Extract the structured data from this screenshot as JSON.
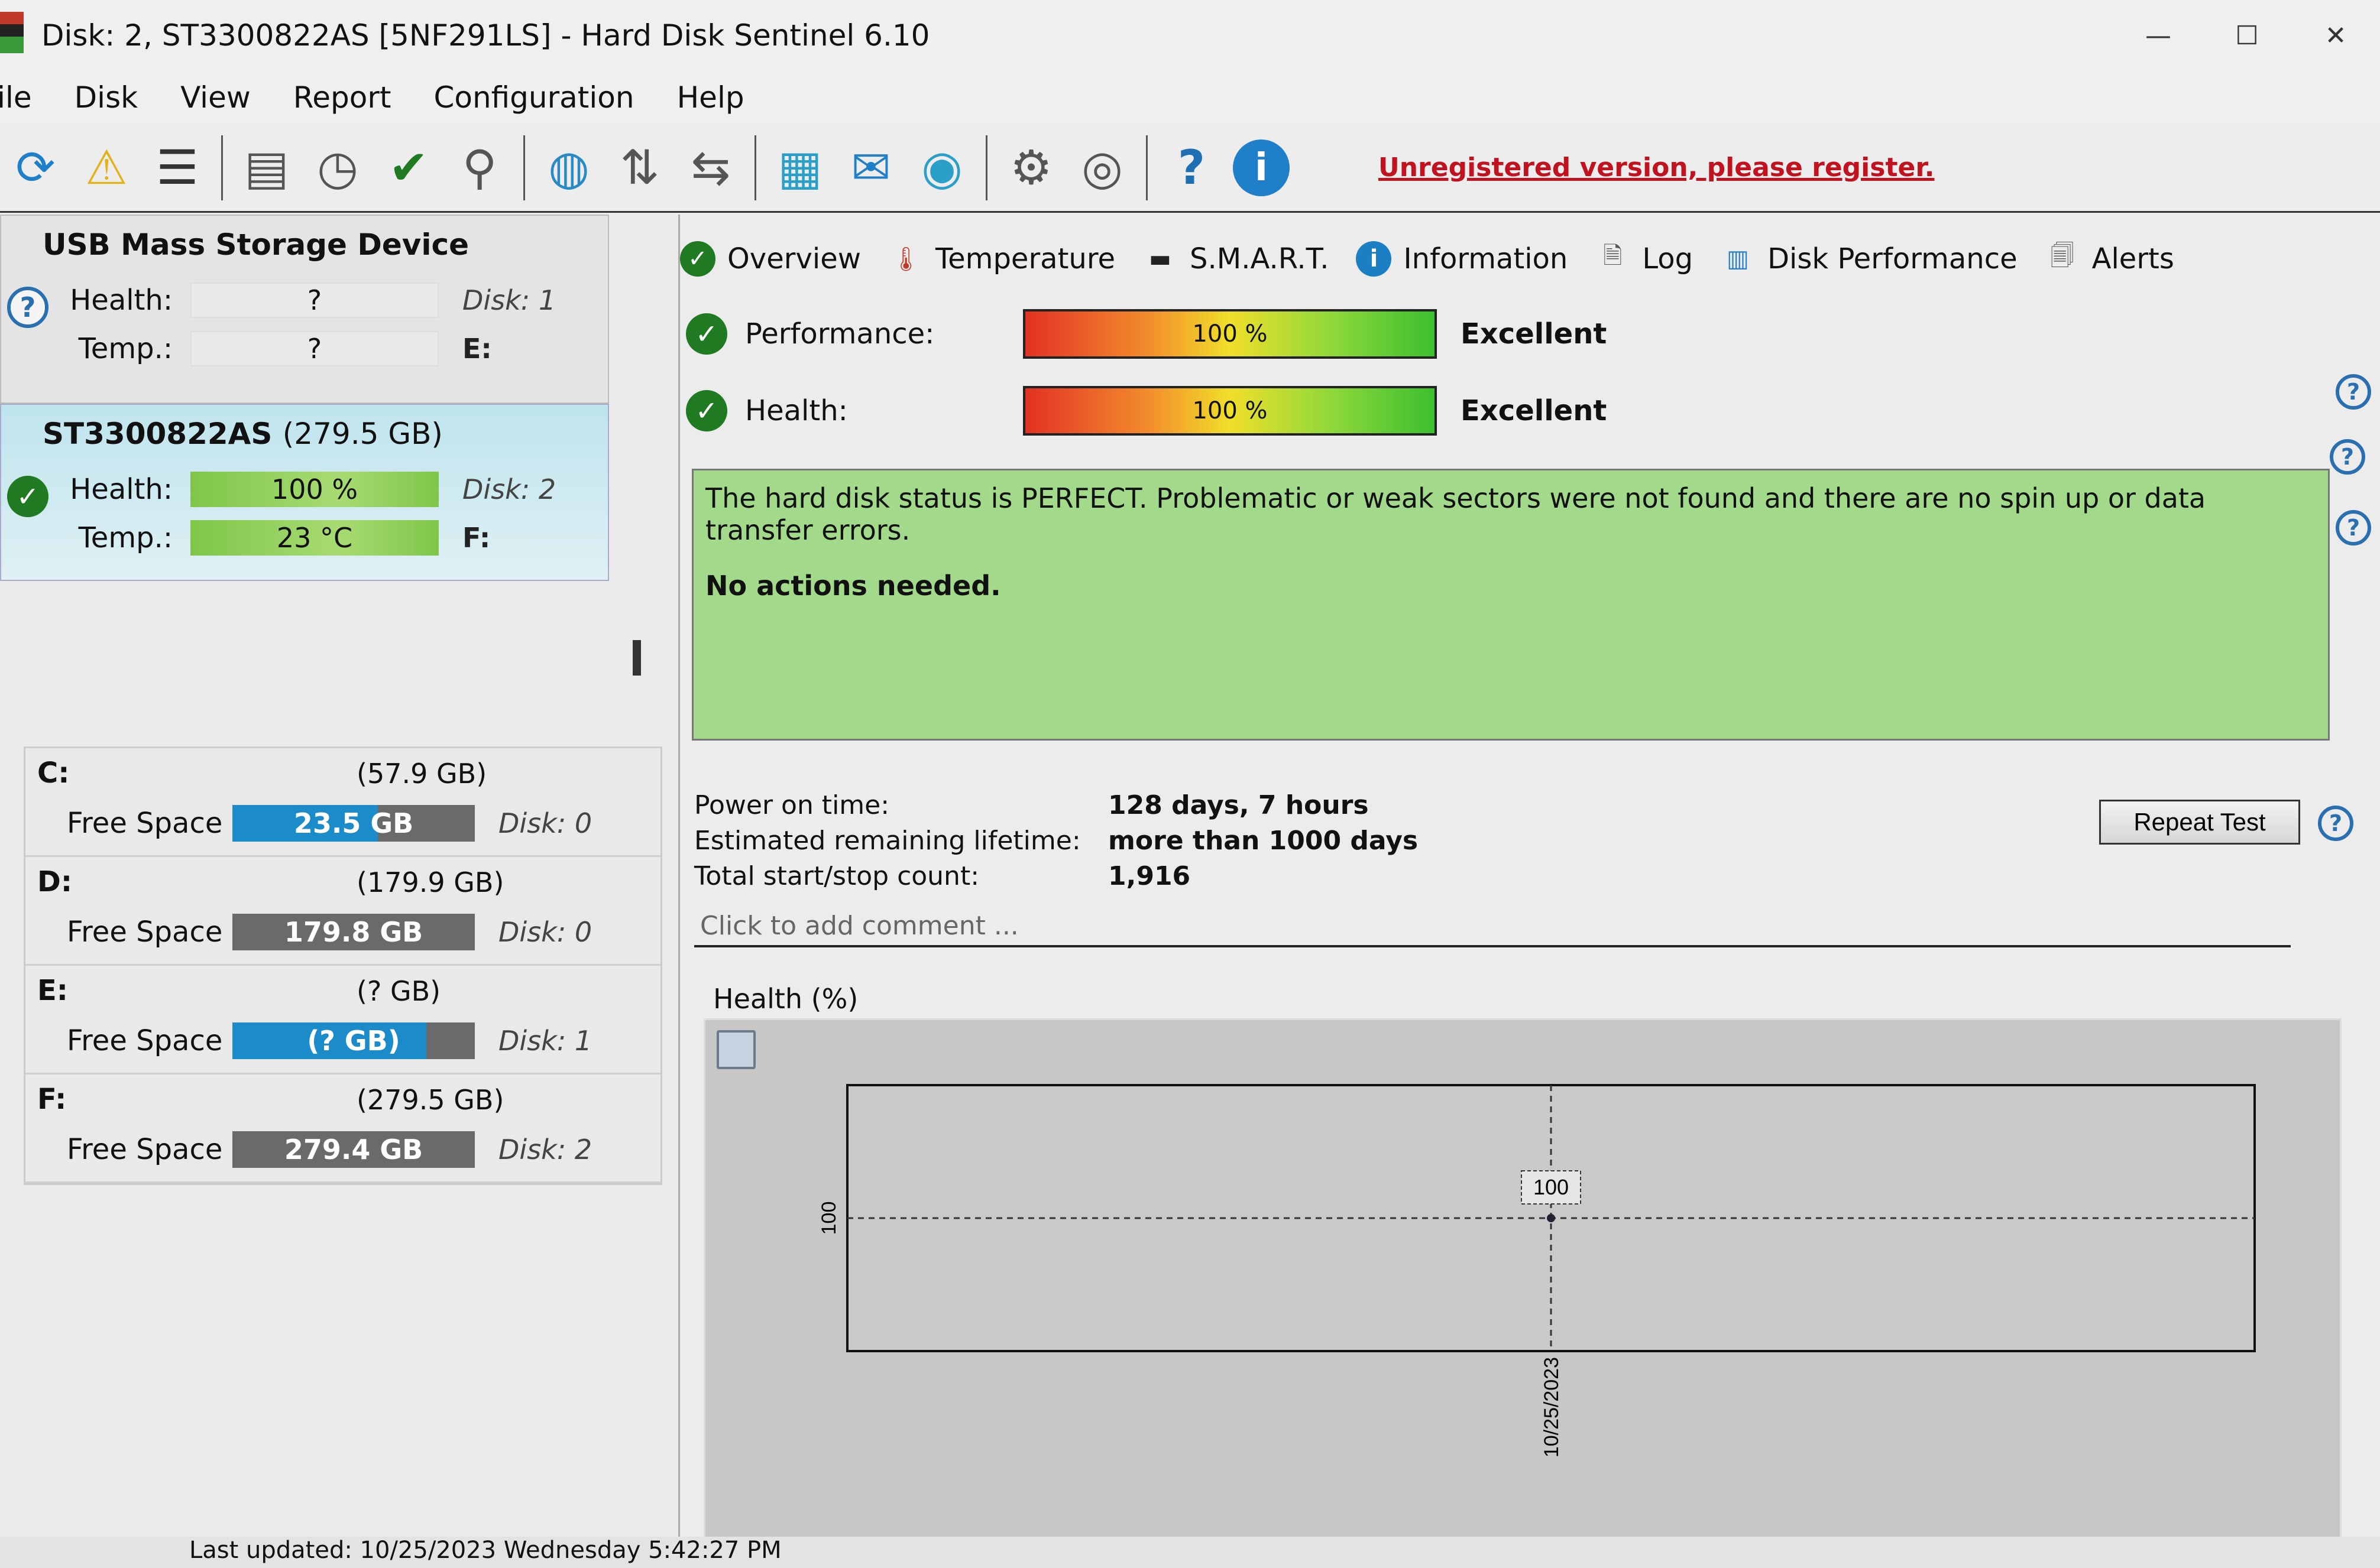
{
  "window": {
    "title": "Disk: 2, ST3300822AS [5NF291LS]  -  Hard Disk Sentinel 6.10",
    "controls": {
      "minimize": "—",
      "maximize": "☐",
      "close": "✕"
    }
  },
  "menu": [
    "File",
    "Disk",
    "View",
    "Report",
    "Configuration",
    "Help"
  ],
  "toolbar": {
    "icons": [
      {
        "name": "refresh-icon",
        "glyph": "⟳"
      },
      {
        "name": "refresh-warning-icon",
        "glyph": "⚠"
      },
      {
        "name": "drive-list-icon",
        "glyph": "☰"
      },
      {
        "name": "disk-surface-test-icon",
        "glyph": "▤"
      },
      {
        "name": "disk-schedule-icon",
        "glyph": "◷"
      },
      {
        "name": "disk-ok-icon",
        "glyph": "✔"
      },
      {
        "name": "disk-search-icon",
        "glyph": "⚲"
      },
      {
        "name": "network-disk-icon",
        "glyph": "◍"
      },
      {
        "name": "network-share-icon",
        "glyph": "⇅"
      },
      {
        "name": "remote-icon",
        "glyph": "⇆"
      },
      {
        "name": "report-notepad-icon",
        "glyph": "▦"
      },
      {
        "name": "email-report-icon",
        "glyph": "✉"
      },
      {
        "name": "web-report-icon",
        "glyph": "◉"
      },
      {
        "name": "settings-gear-icon",
        "glyph": "⚙"
      },
      {
        "name": "sound-icon",
        "glyph": "◎"
      },
      {
        "name": "help-icon",
        "glyph": "?"
      },
      {
        "name": "about-info-icon",
        "glyph": "i"
      }
    ],
    "unregistered_link": "Unregistered version, please register."
  },
  "disks": [
    {
      "title": "USB Mass Storage Device",
      "capacity": "",
      "status_icon": "?",
      "health_label": "Health:",
      "health": "?",
      "temp_label": "Temp.:",
      "temp": "?",
      "disk_label": "Disk: 1",
      "drive_letter": "E:"
    },
    {
      "title": "ST3300822AS",
      "capacity": "(279.5 GB)",
      "status_icon": "✓",
      "health_label": "Health:",
      "health": "100 %",
      "temp_label": "Temp.:",
      "temp": "23 °C",
      "disk_label": "Disk: 2",
      "drive_letter": "F:"
    }
  ],
  "volumes": [
    {
      "letter": "C:",
      "capacity": "(57.9 GB)",
      "free_label": "Free Space",
      "free": "23.5 GB",
      "used_fraction": 0.6,
      "disk": "Disk: 0"
    },
    {
      "letter": "D:",
      "capacity": "(179.9 GB)",
      "free_label": "Free Space",
      "free": "179.8 GB",
      "used_fraction": 0.0,
      "disk": "Disk: 0"
    },
    {
      "letter": "E:",
      "capacity": "(? GB)",
      "free_label": "Free Space",
      "free": "(? GB)",
      "used_fraction": 0.8,
      "disk": "Disk: 1"
    },
    {
      "letter": "F:",
      "capacity": "(279.5 GB)",
      "free_label": "Free Space",
      "free": "279.4 GB",
      "used_fraction": 0.0,
      "disk": "Disk: 2"
    }
  ],
  "tabs": [
    {
      "label": "Overview",
      "icon": "✓"
    },
    {
      "label": "Temperature",
      "icon": "🌡"
    },
    {
      "label": "S.M.A.R.T.",
      "icon": "▬"
    },
    {
      "label": "Information",
      "icon": "i"
    },
    {
      "label": "Log",
      "icon": "🗎"
    },
    {
      "label": "Disk Performance",
      "icon": "▥"
    },
    {
      "label": "Alerts",
      "icon": "🗐"
    }
  ],
  "overview": {
    "performance": {
      "label": "Performance:",
      "value": "100 %",
      "percent": 100,
      "rating": "Excellent"
    },
    "health": {
      "label": "Health:",
      "value": "100 %",
      "percent": 100,
      "rating": "Excellent"
    },
    "status_text": "The hard disk status is PERFECT. Problematic or weak sectors were not found and there are no spin up or data transfer errors.",
    "action_text": "No actions needed.",
    "colors": {
      "status_bg": "#a2d98a"
    },
    "info": [
      {
        "key": "Power on time:",
        "value": "128 days, 7 hours"
      },
      {
        "key": "Estimated remaining lifetime:",
        "value": "more than 1000 days"
      },
      {
        "key": "Total start/stop count:",
        "value": "1,916"
      }
    ],
    "repeat_button": "Repeat Test",
    "comment_placeholder": "Click to add comment ...",
    "help_glyph": "?"
  },
  "chart_data": {
    "type": "line",
    "title": "Health (%)",
    "x": [
      "10/25/2023"
    ],
    "series": [
      {
        "name": "Health",
        "values": [
          100
        ]
      }
    ],
    "ytick_labels": [
      "100"
    ],
    "data_labels": [
      "100"
    ],
    "xlabel": "",
    "ylabel": "",
    "grid": true
  },
  "statusbar": {
    "text": "Last updated: 10/25/2023 Wednesday 5:42:27 PM"
  }
}
